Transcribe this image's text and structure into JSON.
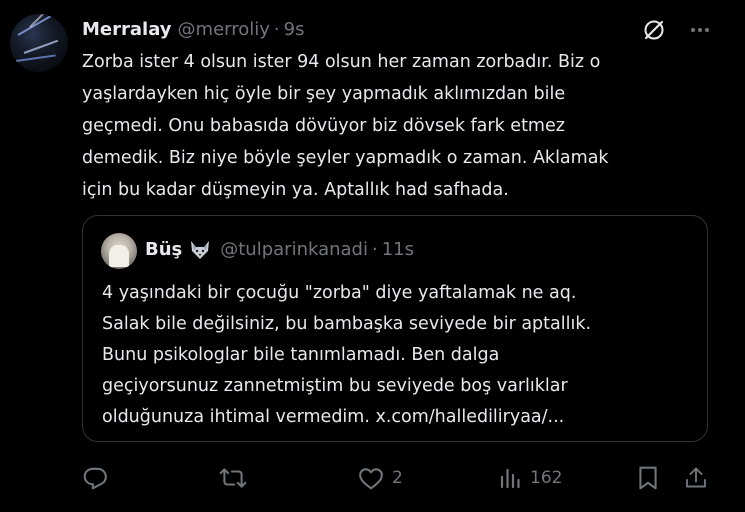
{
  "tweet": {
    "display_name": "Merralay",
    "handle": "@merroliy",
    "separator": "·",
    "time": "9s",
    "text_lines": [
      "Zorba ister 4 olsun ister 94 olsun her zaman zorbadır. Biz o",
      "yaşlardayken hiç öyle bir şey yapmadık aklımızdan bile",
      "geçmedi. Onu babasıda dövüyor biz dövsek fark etmez",
      "demedik. Biz niye böyle şeyler yapmadık o zaman. Aklamak",
      "için bu kadar düşmeyin ya. Aptallık had safhada."
    ],
    "header_icons": [
      "grok-icon",
      "more-icon"
    ]
  },
  "quote": {
    "display_name": "Büş",
    "emoji": "wolf-emoji",
    "handle": "@tulparinkanadi",
    "separator": "·",
    "time": "11s",
    "text_lines": [
      "4 yaşındaki bir çocuğu \"zorba\" diye yaftalamak ne aq.",
      "Salak bile değilsiniz, bu bambaşka seviyede bir aptallık.",
      "Bunu psikologlar bile tanımlamadı. Ben dalga",
      "geçiyorsunuz zannetmiştim bu seviyede boş varlıklar",
      "olduğunuza ihtimal vermedim. x.com/hallediliryaa/..."
    ]
  },
  "actions": {
    "reply_icon": "reply-icon",
    "retweet_icon": "retweet-icon",
    "like_icon": "heart-icon",
    "like_count": "2",
    "views_icon": "views-icon",
    "views_count": "162",
    "bookmark_icon": "bookmark-icon",
    "share_icon": "share-icon"
  },
  "colors": {
    "background": "#000000",
    "text": "#e7e9ea",
    "muted": "#71767b",
    "border": "#2f3336"
  }
}
